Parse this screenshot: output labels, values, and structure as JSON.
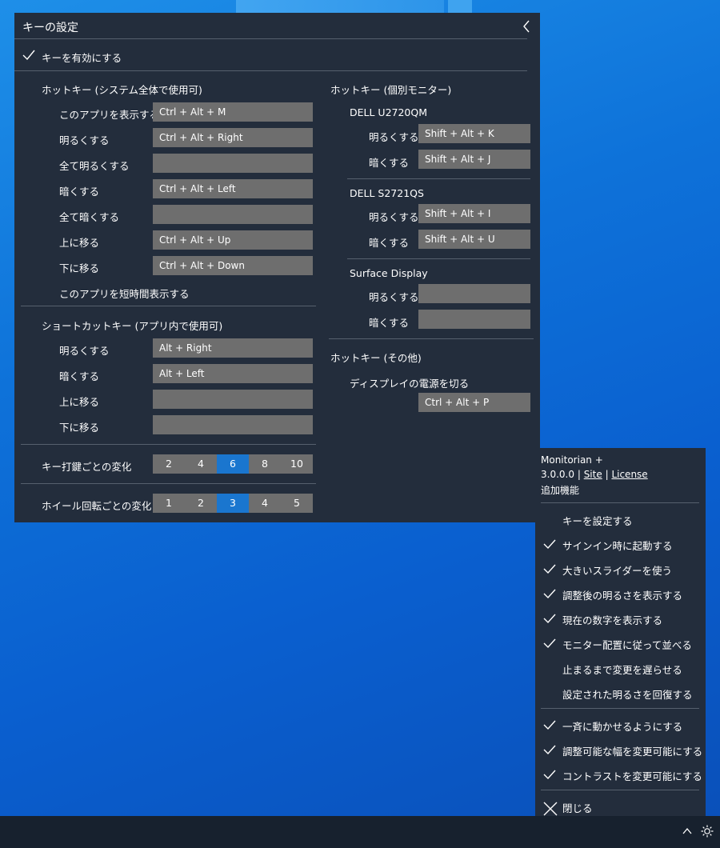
{
  "panel": {
    "title": "キーの設定",
    "enable_label": "キーを有効にする",
    "hotkeys_system": {
      "title": "ホットキー (システム全体で使用可)",
      "rows": [
        {
          "label": "このアプリを表示する",
          "value": "Ctrl + Alt + M"
        },
        {
          "label": "明るくする",
          "value": "Ctrl + Alt + Right"
        },
        {
          "label": "全て明るくする",
          "value": ""
        },
        {
          "label": "暗くする",
          "value": "Ctrl + Alt + Left"
        },
        {
          "label": "全て暗くする",
          "value": ""
        },
        {
          "label": "上に移る",
          "value": "Ctrl + Alt + Up"
        },
        {
          "label": "下に移る",
          "value": "Ctrl + Alt + Down"
        }
      ],
      "short_show_label": "このアプリを短時間表示する"
    },
    "shortcut_app": {
      "title": "ショートカットキー (アプリ内で使用可)",
      "rows": [
        {
          "label": "明るくする",
          "value": "Alt + Right"
        },
        {
          "label": "暗くする",
          "value": "Alt + Left"
        },
        {
          "label": "上に移る",
          "value": ""
        },
        {
          "label": "下に移る",
          "value": ""
        }
      ]
    },
    "key_step": {
      "label": "キー打鍵ごとの変化",
      "options": [
        "2",
        "4",
        "6",
        "8",
        "10"
      ],
      "selected": "6"
    },
    "wheel_step": {
      "label": "ホイール回転ごとの変化",
      "options": [
        "1",
        "2",
        "3",
        "4",
        "5"
      ],
      "selected": "3"
    },
    "hotkeys_monitor": {
      "title": "ホットキー (個別モニター)",
      "monitors": [
        {
          "name": "DELL U2720QM",
          "brighter_label": "明るくする",
          "brighter": "Shift + Alt + K",
          "darker_label": "暗くする",
          "darker": "Shift + Alt + J"
        },
        {
          "name": "DELL S2721QS",
          "brighter_label": "明るくする",
          "brighter": "Shift + Alt + I",
          "darker_label": "暗くする",
          "darker": "Shift + Alt + U"
        },
        {
          "name": "Surface Display",
          "brighter_label": "明るくする",
          "brighter": "",
          "darker_label": "暗くする",
          "darker": ""
        }
      ]
    },
    "hotkeys_other": {
      "title": "ホットキー (その他)",
      "power_off_label": "ディスプレイの電源を切る",
      "power_off_value": "Ctrl + Alt + P"
    }
  },
  "menu": {
    "app_name": "Monitorian +",
    "version": "3.0.0.0",
    "separator": "|",
    "site_link": "Site",
    "license_link": "License",
    "extra_features": "追加機能",
    "items": [
      {
        "label": "キーを設定する",
        "checked": false
      },
      {
        "label": "サインイン時に起動する",
        "checked": true
      },
      {
        "label": "大きいスライダーを使う",
        "checked": true
      },
      {
        "label": "調整後の明るさを表示する",
        "checked": true
      },
      {
        "label": "現在の数字を表示する",
        "checked": true
      },
      {
        "label": "モニター配置に従って並べる",
        "checked": true
      },
      {
        "label": "止まるまで変更を遅らせる",
        "checked": false
      },
      {
        "label": "設定された明るさを回復する",
        "checked": false
      }
    ],
    "items2": [
      {
        "label": "一斉に動かせるようにする",
        "checked": true
      },
      {
        "label": "調整可能な幅を変更可能にする",
        "checked": true
      },
      {
        "label": "コントラストを変更可能にする",
        "checked": true
      }
    ],
    "close_label": "閉じる"
  }
}
